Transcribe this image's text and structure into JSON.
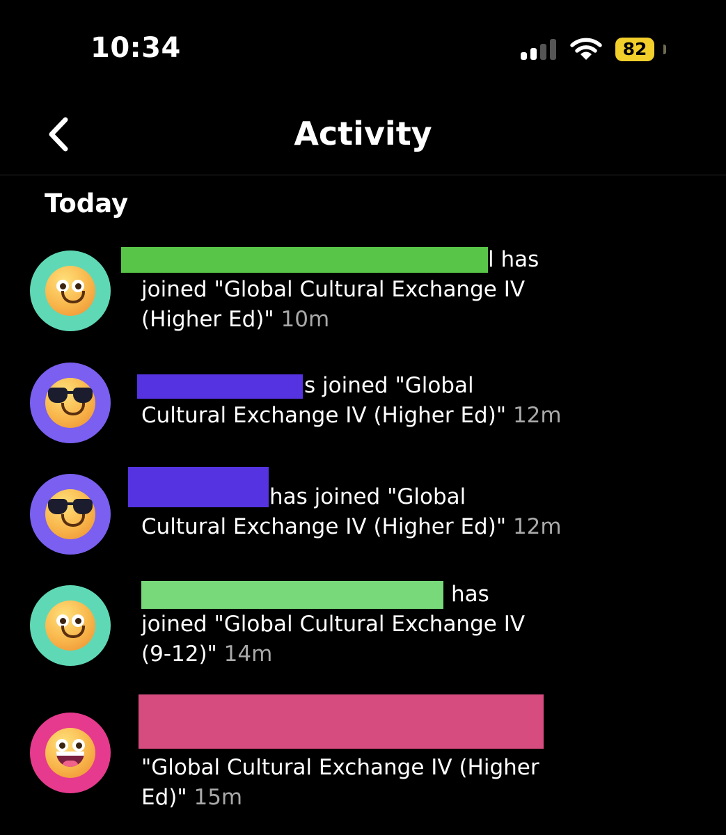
{
  "status_bar": {
    "time": "10:34",
    "battery_level": "82"
  },
  "header": {
    "title": "Activity",
    "back_icon": "chevron-left-icon"
  },
  "section_title": "Today",
  "colors": {
    "avatar_teal": "#5fd9b5",
    "avatar_purple": "#7a5ff0",
    "avatar_pink": "#e63a8e",
    "redact_green": "#58c548",
    "redact_light_green": "#78d97a",
    "redact_blue": "#5533e0",
    "redact_pink": "#d64c7e",
    "battery": "#f3cf2c"
  },
  "activities": [
    {
      "avatar_icon": "slightly-smiling-face-icon",
      "line1": "l has",
      "line2": "joined \"Global Cultural Exchange IV",
      "line3": "(Higher Ed)\"",
      "time": "10m"
    },
    {
      "avatar_icon": "smiling-face-with-sunglasses-icon",
      "line1": "s joined \"Global",
      "line2": "Cultural Exchange IV (Higher Ed)\"",
      "time": "12m"
    },
    {
      "avatar_icon": "smiling-face-with-sunglasses-icon",
      "line1": "has joined \"Global",
      "line2": "Cultural Exchange IV (Higher Ed)\"",
      "time": "12m"
    },
    {
      "avatar_icon": "slightly-smiling-face-icon",
      "line1": "has",
      "line2": "joined \"Global Cultural Exchange IV",
      "line3": "(9-12)\"",
      "time": "14m"
    },
    {
      "avatar_icon": "grinning-face-icon",
      "line2": "\"Global Cultural Exchange IV (Higher",
      "line3": "Ed)\"",
      "time": "15m"
    }
  ]
}
